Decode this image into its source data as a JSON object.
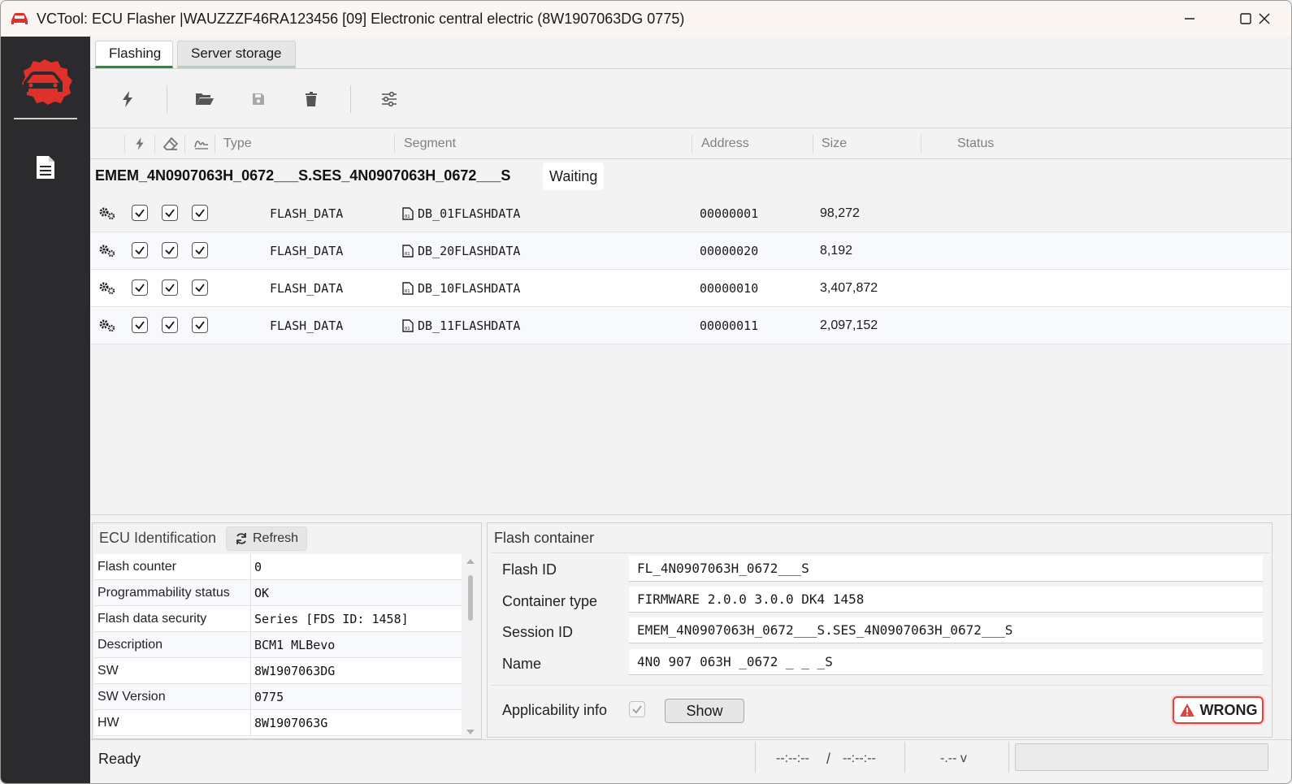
{
  "window": {
    "title": "VCTool: ECU Flasher |WAUZZZF46RA123456 [09] Electronic central electric (8W1907063DG 0775)"
  },
  "tabs": [
    {
      "label": "Flashing",
      "active": true
    },
    {
      "label": "Server storage",
      "active": false
    }
  ],
  "toolbar": {
    "icons": [
      "flash-icon",
      "open-folder-icon",
      "save-icon",
      "delete-icon",
      "settings-sliders-icon"
    ]
  },
  "grid": {
    "columns": {
      "type": "Type",
      "segment": "Segment",
      "address": "Address",
      "size": "Size",
      "status": "Status"
    },
    "group": {
      "title": "EMEM_4N0907063H_0672___S.SES_4N0907063H_0672___S",
      "status": "Waiting"
    },
    "rows": [
      {
        "type": "FLASH_DATA",
        "segment": "DB_01FLASHDATA",
        "address": "00000001",
        "size": "98,272"
      },
      {
        "type": "FLASH_DATA",
        "segment": "DB_20FLASHDATA",
        "address": "00000020",
        "size": "8,192"
      },
      {
        "type": "FLASH_DATA",
        "segment": "DB_10FLASHDATA",
        "address": "00000010",
        "size": "3,407,872"
      },
      {
        "type": "FLASH_DATA",
        "segment": "DB_11FLASHDATA",
        "address": "00000011",
        "size": "2,097,152"
      }
    ]
  },
  "ecu_identification": {
    "title": "ECU Identification",
    "refresh_label": "Refresh",
    "rows": [
      {
        "key": "Flash counter",
        "value": "0"
      },
      {
        "key": "Programmability status",
        "value": "OK"
      },
      {
        "key": "Flash data security",
        "value": "Series [FDS ID: 1458]"
      },
      {
        "key": "Description",
        "value": "BCM1 MLBevo"
      },
      {
        "key": "SW",
        "value": "8W1907063DG"
      },
      {
        "key": "SW Version",
        "value": "0775"
      },
      {
        "key": "HW",
        "value": "8W1907063G"
      }
    ]
  },
  "flash_container": {
    "title": "Flash container",
    "flash_id_label": "Flash ID",
    "flash_id": "FL_4N0907063H_0672___S",
    "container_type_label": "Container type",
    "container_type": "FIRMWARE 2.0.0 3.0.0 DK4 1458",
    "session_id_label": "Session ID",
    "session_id": "EMEM_4N0907063H_0672___S.SES_4N0907063H_0672___S",
    "name_label": "Name",
    "name": "4N0 907 063H _0672 _ _ _S",
    "applicability_label": "Applicability info",
    "applicability_checked": true,
    "show_label": "Show",
    "wrong_label": "WRONG"
  },
  "statusbar": {
    "status": "Ready",
    "time_left": "--:--:--",
    "time_sep": "/",
    "time_right": "--:--:--",
    "voltage": "-.-- v"
  },
  "colors": {
    "sidebar": "#2b2b2e",
    "brand_red": "#e0302a",
    "tab_accent": "#2b8a3e",
    "wrong_border": "#e0433b"
  }
}
